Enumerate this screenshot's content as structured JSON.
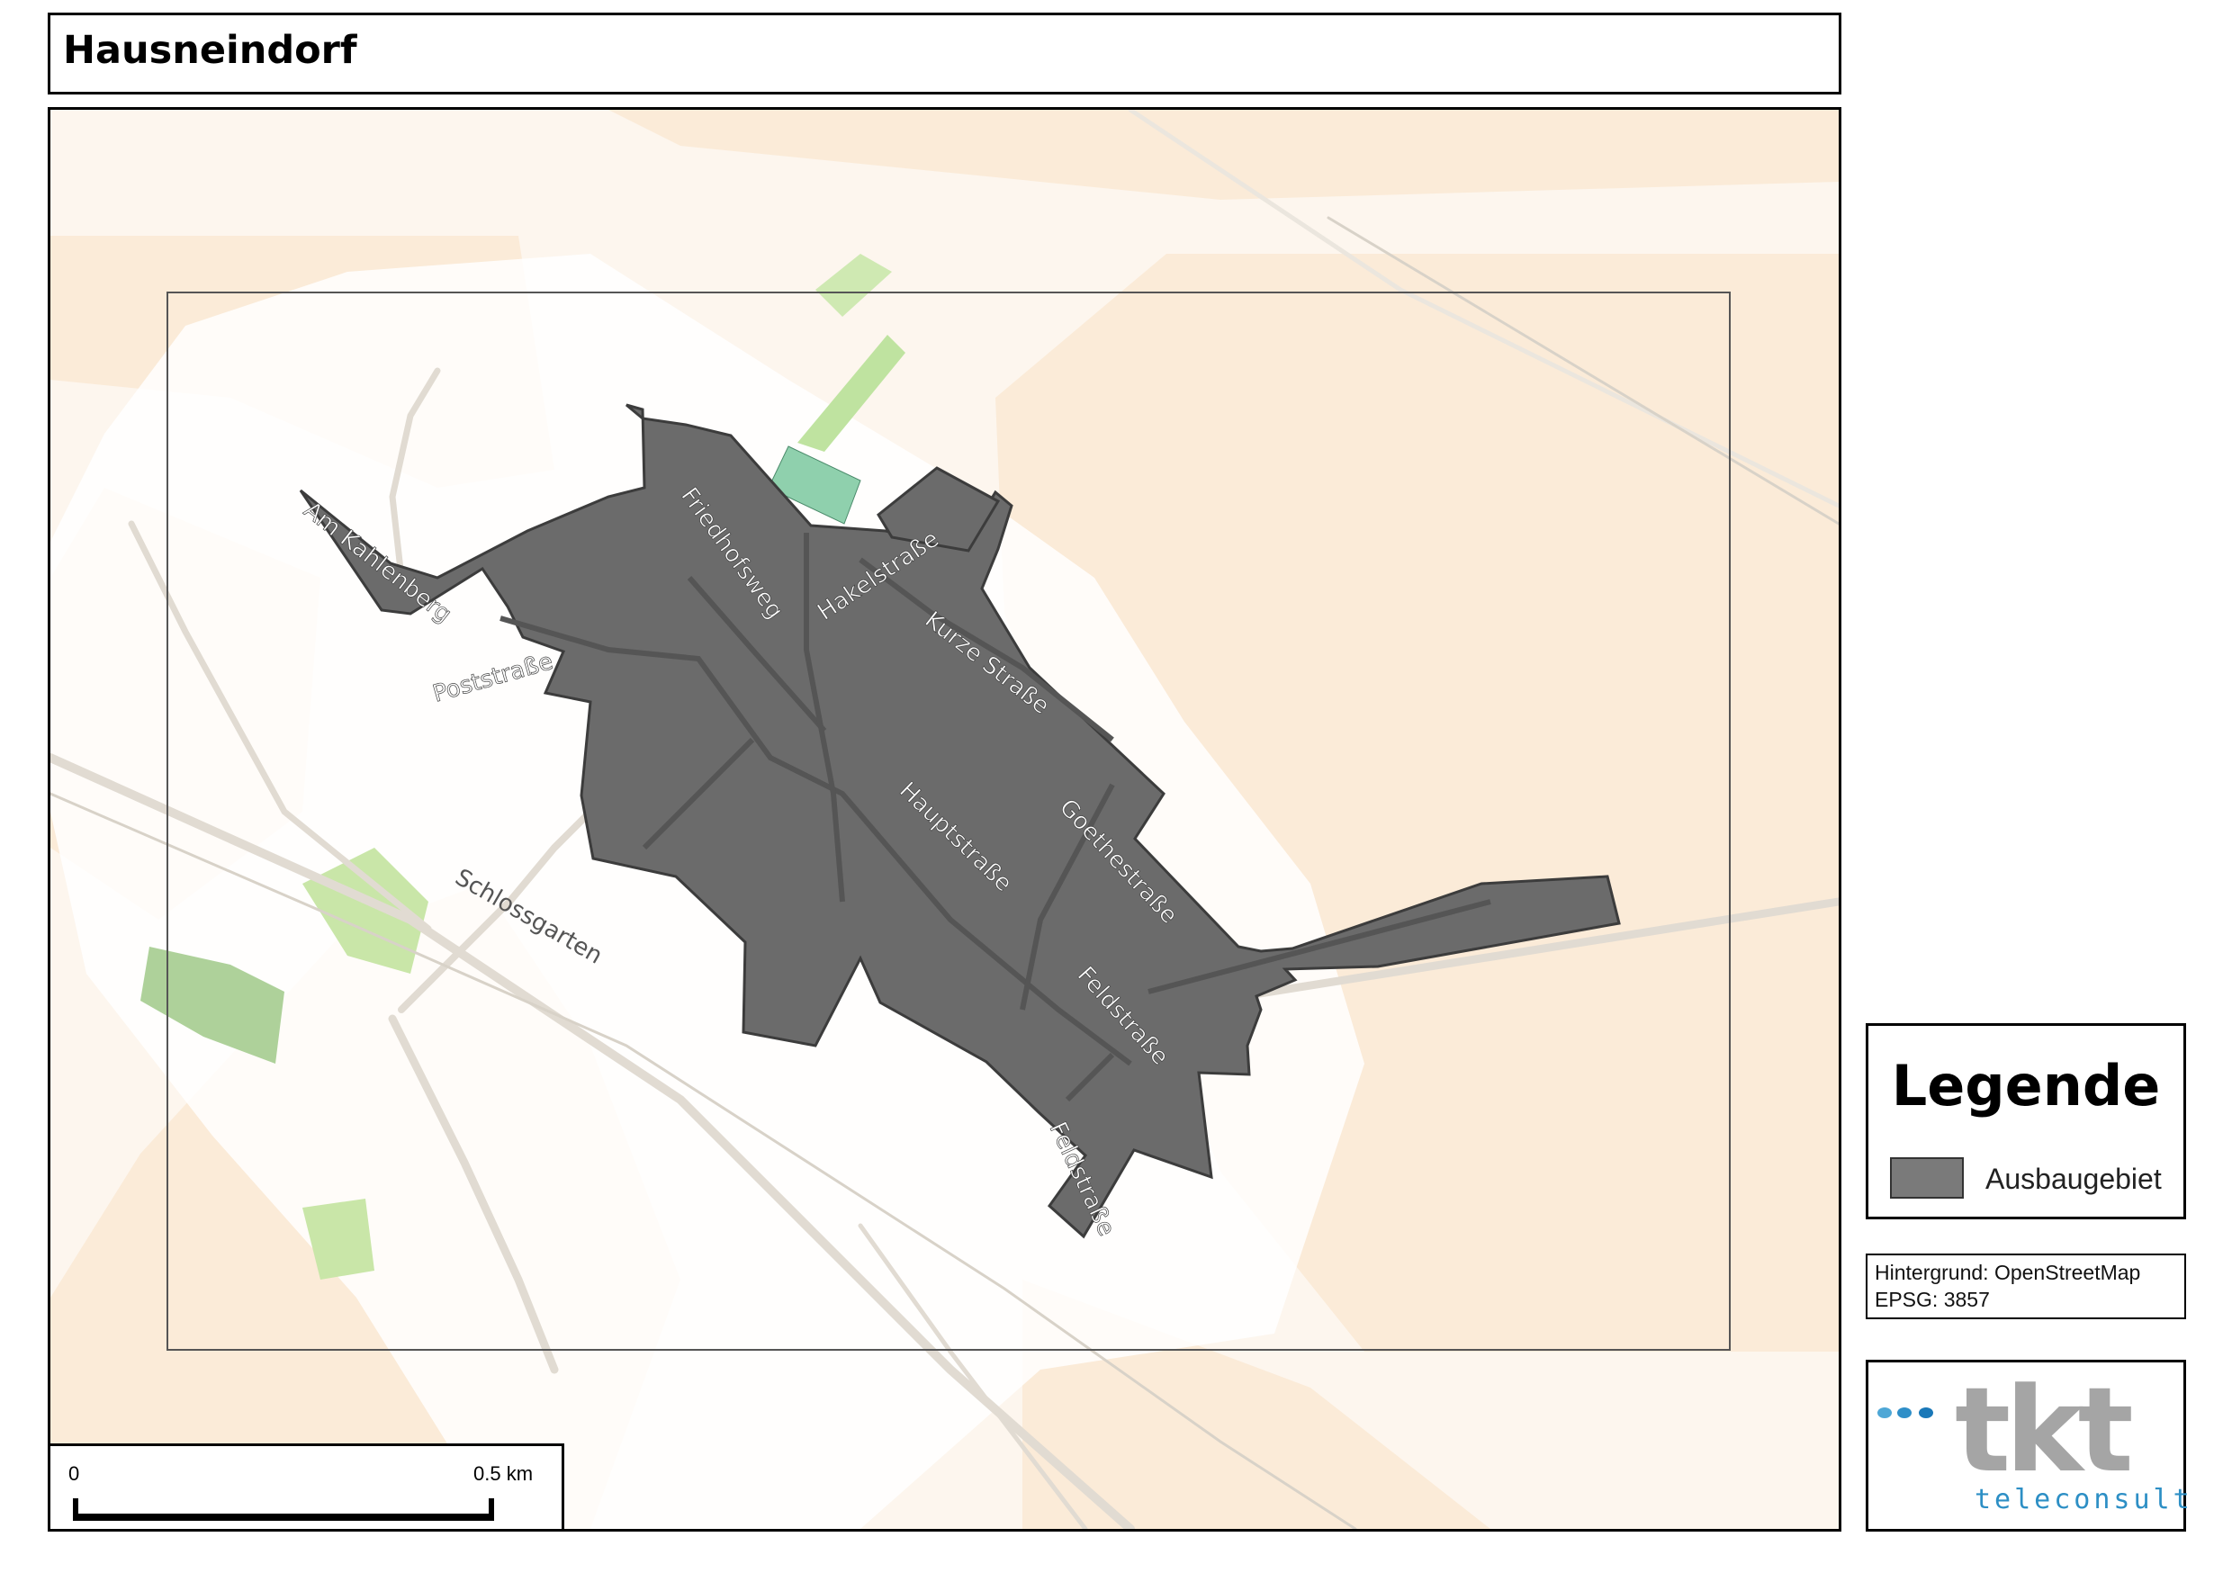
{
  "title": "Hausneindorf",
  "legend": {
    "title": "Legende",
    "items": [
      {
        "label": "Ausbaugebiet",
        "color": "#7a7a7a"
      }
    ]
  },
  "credits": {
    "line1": "Hintergrund: OpenStreetMap",
    "line2": "EPSG: 3857"
  },
  "scale": {
    "start": "0",
    "end": "0.5 km"
  },
  "logo": {
    "mark": "tkt",
    "subtitle": "teleconsult",
    "icon": "tkt-logo"
  },
  "map": {
    "street_labels": [
      "Am Kahlenberg",
      "Friedhofsweg",
      "Hakelstraße",
      "Kurze Straße",
      "Poststraße",
      "Hauptstraße",
      "Goethestraße",
      "Schlossgarten",
      "Feldstraße",
      "Feldstraße"
    ],
    "colors": {
      "farmland": "#f9e8d5",
      "area_fill": "#6b6b6b",
      "green": "#c9e6a8",
      "park": "#8fd0ad",
      "road": "#e3ddd4"
    }
  }
}
